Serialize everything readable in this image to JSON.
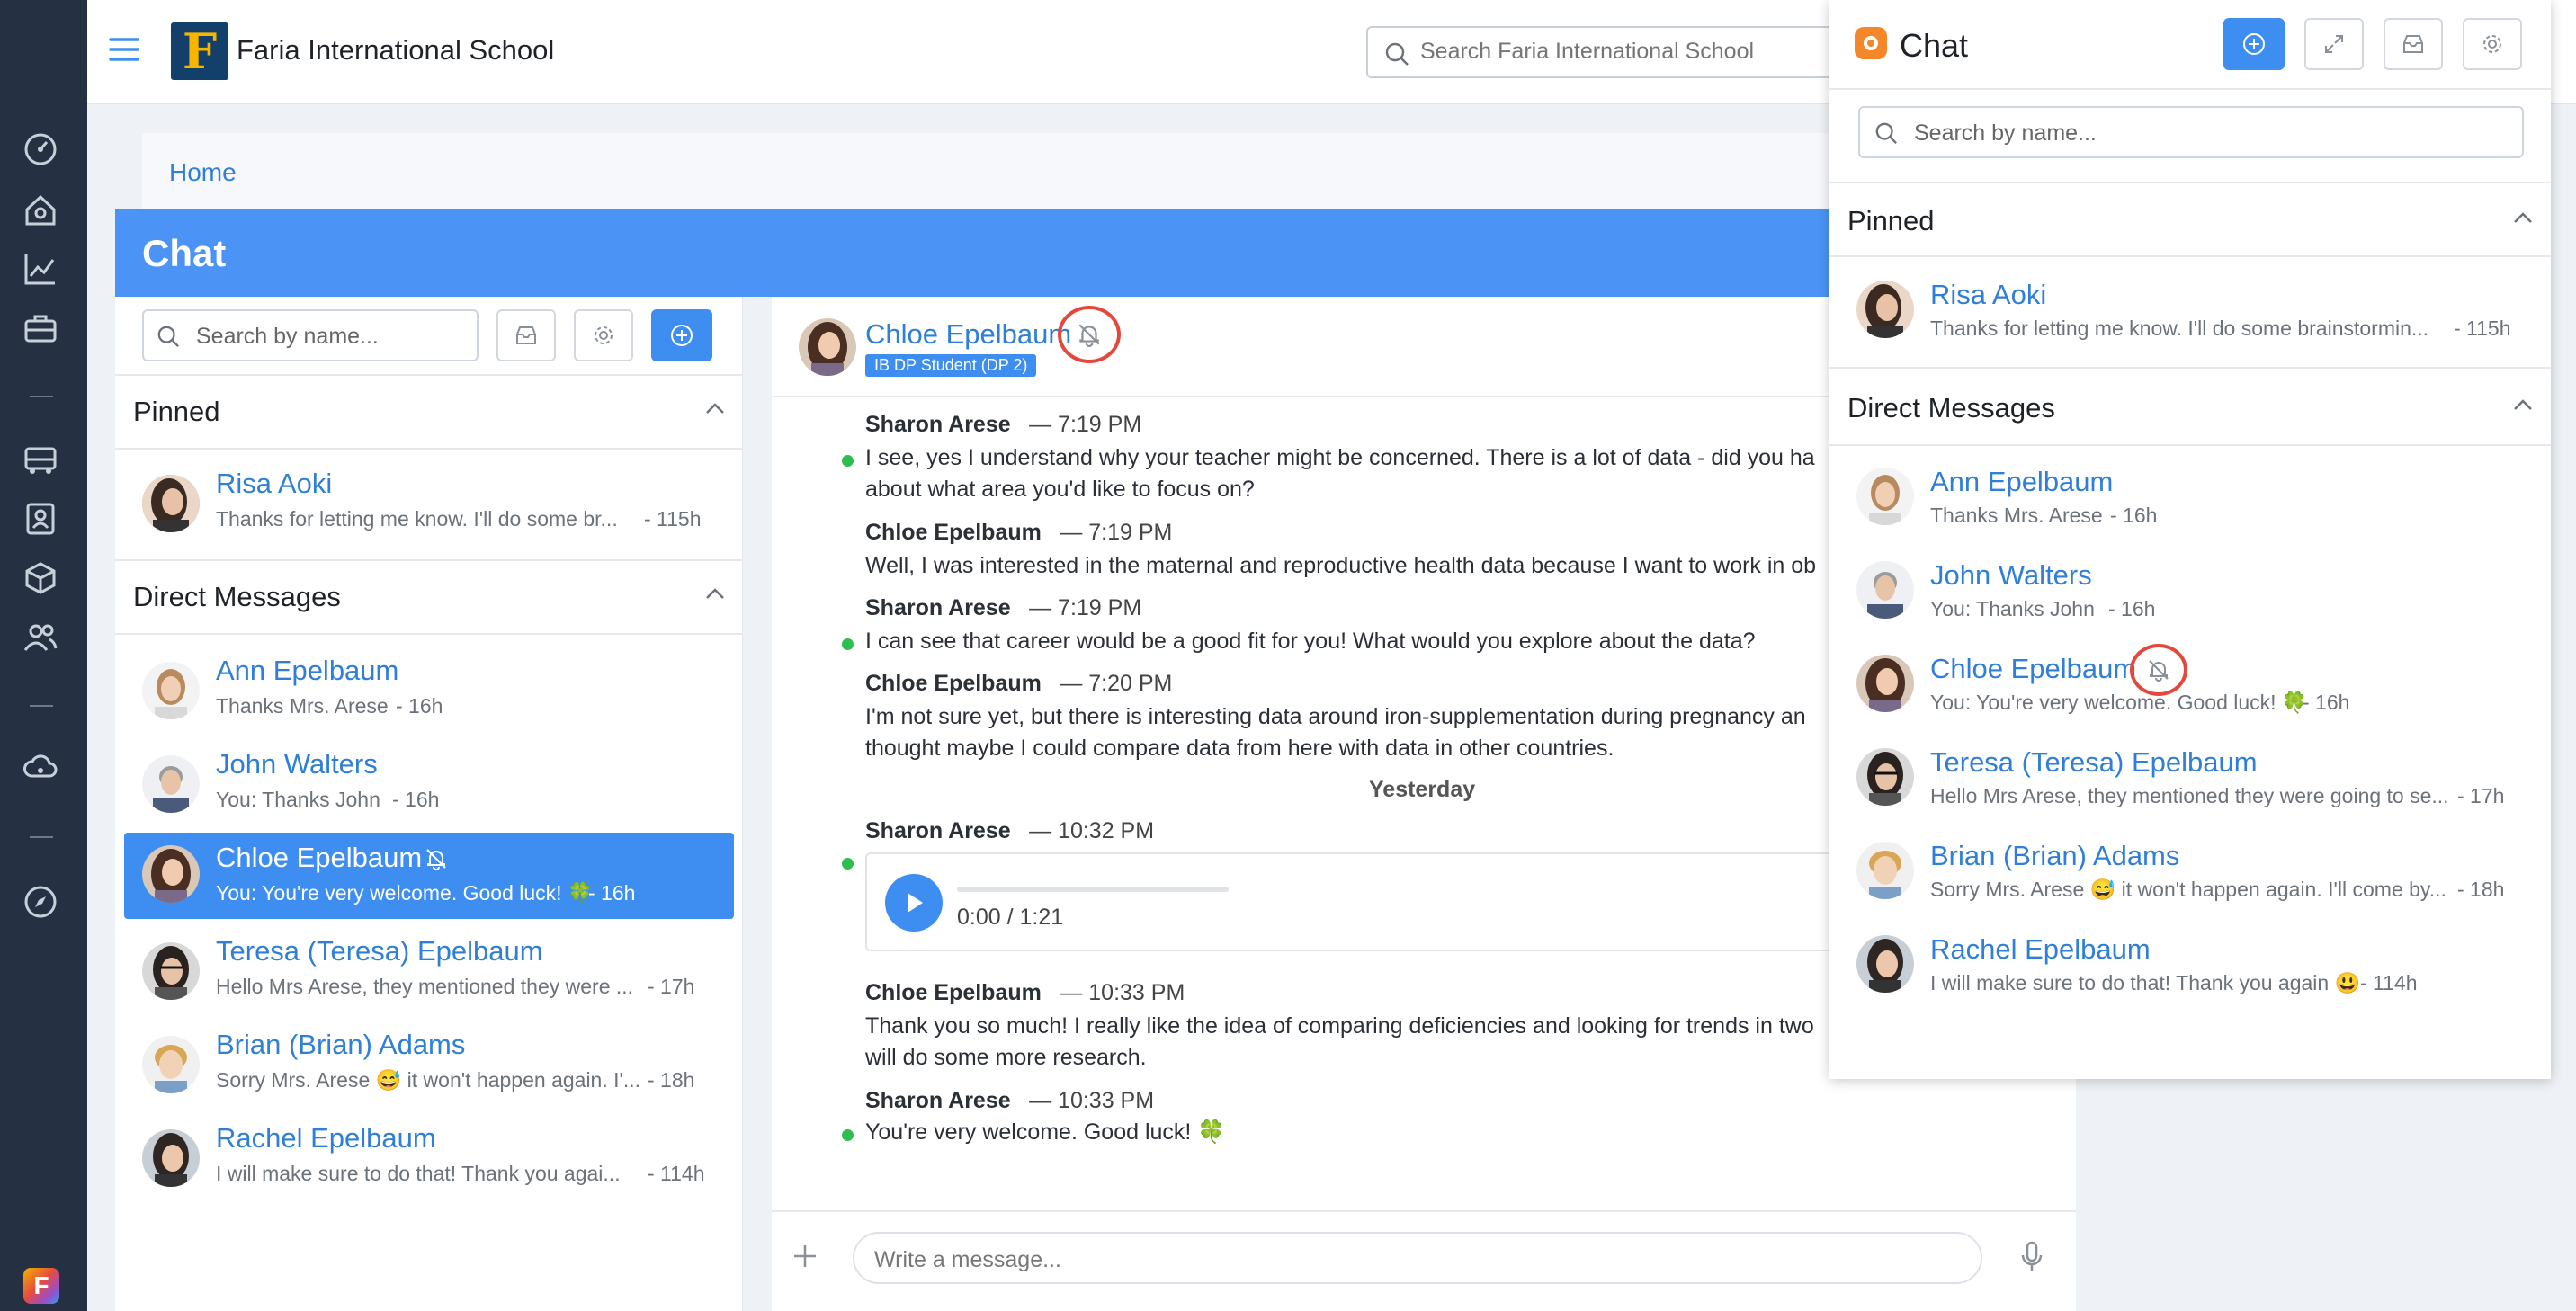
{
  "topbar": {
    "school_name": "Faria International School",
    "search_placeholder": "Search Faria International School",
    "logo_letter": "F"
  },
  "breadcrumb": {
    "home": "Home"
  },
  "main_chat": {
    "title": "Chat",
    "search_placeholder": "Search by name...",
    "pinned_title": "Pinned",
    "dm_title": "Direct Messages",
    "pinned": [
      {
        "name": "Risa Aoki",
        "preview": "Thanks for letting me know. I'll do some br...",
        "time": "- 115h"
      }
    ],
    "direct_messages": [
      {
        "name": "Ann Epelbaum",
        "preview": "Thanks Mrs. Arese",
        "time": "- 16h"
      },
      {
        "name": "John Walters",
        "preview": "You: Thanks John",
        "time": "- 16h"
      },
      {
        "name": "Chloe Epelbaum",
        "preview": "You: You're very welcome. Good luck! 🍀",
        "time": "- 16h",
        "selected": true,
        "muted": true
      },
      {
        "name": "Teresa (Teresa) Epelbaum",
        "preview": "Hello Mrs Arese, they mentioned they were ...",
        "time": "- 17h"
      },
      {
        "name": "Brian (Brian) Adams",
        "preview": "Sorry Mrs. Arese 😅 it won't happen again. I'...",
        "time": "- 18h"
      },
      {
        "name": "Rachel Epelbaum",
        "preview": "I will make sure to do that! Thank you agai...",
        "time": "- 114h"
      }
    ]
  },
  "conversation": {
    "contact_name": "Chloe Epelbaum",
    "contact_badge": "IB DP Student (DP 2)",
    "day_separator": "Yesterday",
    "messages": [
      {
        "author": "Sharon Arese",
        "time": "— 7:19 PM",
        "lines": [
          "I see, yes I understand why your teacher might be concerned. There is a lot of data - did you ha",
          "about what area you'd like to focus on?"
        ]
      },
      {
        "author": "Chloe Epelbaum",
        "time": "— 7:19 PM",
        "lines": [
          "Well, I was interested in the maternal and reproductive health data because I want to work in ob"
        ]
      },
      {
        "author": "Sharon Arese",
        "time": "— 7:19 PM",
        "lines": [
          "I can see that career would be a good fit for you! What would you explore about the data?"
        ]
      },
      {
        "author": "Chloe Epelbaum",
        "time": "— 7:20 PM",
        "lines": [
          "I'm not sure yet, but there is interesting data around iron-supplementation during pregnancy an",
          "thought maybe I could compare data from here with data in other countries."
        ]
      },
      {
        "author": "Sharon Arese",
        "time": "— 10:32 PM",
        "lines": []
      },
      {
        "author": "Chloe Epelbaum",
        "time": "— 10:33 PM",
        "lines": [
          "Thank you so much! I really like the idea of comparing deficiencies and looking for trends in two",
          "will do some more research."
        ]
      },
      {
        "author": "Sharon Arese",
        "time": "— 10:33 PM",
        "lines": [
          "You're very welcome. Good luck! 🍀"
        ]
      }
    ],
    "audio": {
      "time": "0:00 / 1:21",
      "progress": 0.0
    },
    "composer_placeholder": "Write a message..."
  },
  "popup": {
    "title": "Chat",
    "search_placeholder": "Search by name...",
    "pinned_title": "Pinned",
    "dm_title": "Direct Messages",
    "pinned": [
      {
        "name": "Risa Aoki",
        "preview": "Thanks for letting me know. I'll do some brainstormin...",
        "time": "- 115h"
      }
    ],
    "direct_messages": [
      {
        "name": "Ann Epelbaum",
        "preview": "Thanks Mrs. Arese",
        "time": "- 16h"
      },
      {
        "name": "John Walters",
        "preview": "You: Thanks John",
        "time": "- 16h"
      },
      {
        "name": "Chloe Epelbaum",
        "preview": "You: You're very welcome. Good luck! 🍀",
        "time": "- 16h",
        "muted": true
      },
      {
        "name": "Teresa (Teresa) Epelbaum",
        "preview": "Hello Mrs Arese, they mentioned they were going to se...",
        "time": "- 17h"
      },
      {
        "name": "Brian (Brian) Adams",
        "preview": "Sorry Mrs. Arese 😅 it won't happen again. I'll come by...",
        "time": "- 18h"
      },
      {
        "name": "Rachel Epelbaum",
        "preview": "I will make sure to do that! Thank you again 😃",
        "time": "- 114h"
      }
    ]
  },
  "colors": {
    "accent": "#3e8ef2",
    "header": "#4b94f5",
    "rail": "#253142",
    "online": "#2dbe4f",
    "highlight": "#e4483d",
    "link": "#2f7fd8"
  },
  "icons": [
    "menu-icon",
    "dashboard-icon",
    "home-icon",
    "chart-icon",
    "briefcase-icon",
    "bus-icon",
    "id-card-icon",
    "box-icon",
    "people-icon",
    "cloud-icon",
    "compass-icon",
    "search-icon",
    "inbox-icon",
    "gear-icon",
    "plus-icon",
    "expand-icon",
    "chevron-up-icon",
    "bell-off-icon",
    "play-icon",
    "mic-icon"
  ]
}
